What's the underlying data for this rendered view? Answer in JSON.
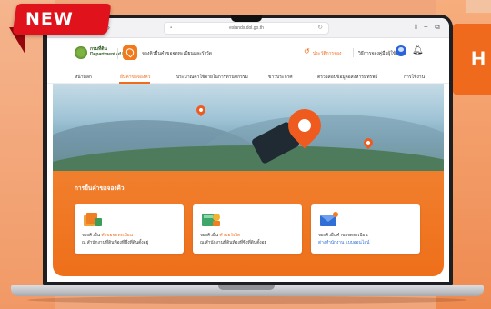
{
  "badge": {
    "text": "NEW"
  },
  "background": {
    "right_letter": "H"
  },
  "browser": {
    "url": "eslands.dol.go.th",
    "back_icon": "chevron-left-icon",
    "forward_icon": "chevron-right-icon",
    "share_icon": "share-icon",
    "newtab_icon": "plus-icon",
    "tabs_icon": "tabs-icon"
  },
  "header": {
    "dept_logo_text": [
      "กรมที่ดิน",
      "Department of Lands"
    ],
    "app_name": "จองคิวยื่นคำขอจดทะเบียนและรังวัด",
    "history_link": "ประวัติการจอง",
    "manual_link": "วิธีการจองคู่มือผู้ใช้",
    "icons": [
      "history-icon",
      "user-icon",
      "bell-icon"
    ]
  },
  "menu": {
    "items": [
      {
        "label": "หน้าหลัก",
        "active": false
      },
      {
        "label": "ยื่นคำขอจองคิว",
        "active": true
      },
      {
        "label": "ประมาณค่าใช้จ่ายในการทำนิติกรรม",
        "active": false
      },
      {
        "label": "ข่าวประกาศ",
        "active": false
      },
      {
        "label": "ตรวจสอบข้อมูลอสังหาริมทรัพย์",
        "active": false
      },
      {
        "label": "การใช้งาน",
        "active": false
      }
    ]
  },
  "panel": {
    "title": "การยื่นคำขอจองคิว",
    "cards": [
      {
        "line1_a": "จองคิวยื่น ",
        "line1_hl": "คำขอจดทะเบียน",
        "line2_a": "ณ สำนักงานที่ดินท้องที่ซึ่งที่ดินตั้งอยู่",
        "line2_hl": ""
      },
      {
        "line1_a": "จองคิวยื่น ",
        "line1_hl": "คำขอรังวัด",
        "line2_a": "ณ สำนักงานที่ดินท้องที่ซึ่งที่ดินตั้งอยู่",
        "line2_hl": ""
      },
      {
        "line1_a": "จองคิวยื่นคำขอจดทะเบียน",
        "line1_hl": "",
        "line2_a": "",
        "line2_hl": "ต่างสำนักงาน แบบออนไลน์"
      }
    ]
  },
  "colors": {
    "accent": "#ef6c1a",
    "badge": "#e0121b",
    "link_blue": "#2f6fd6"
  }
}
